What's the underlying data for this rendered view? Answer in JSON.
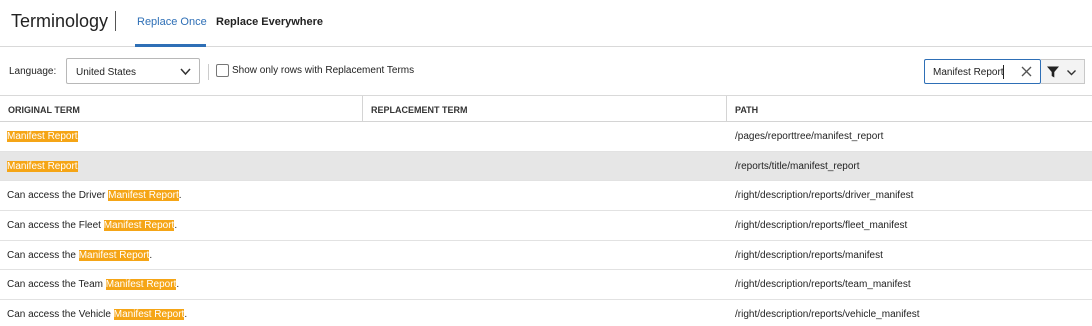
{
  "header": {
    "title": "Terminology",
    "tabs": [
      {
        "label": "Replace Once",
        "active": true
      },
      {
        "label": "Replace Everywhere",
        "active": false
      }
    ]
  },
  "toolbar": {
    "language_label": "Language:",
    "language_value": "United States",
    "checkbox_label": "Show only rows with Replacement Terms",
    "checkbox_checked": false,
    "search_value": "Manifest Report"
  },
  "table": {
    "columns": [
      "ORIGINAL TERM",
      "REPLACEMENT TERM",
      "PATH"
    ],
    "rows": [
      {
        "prefix": "",
        "match": "Manifest Report",
        "suffix": "",
        "replacement": "",
        "path": "/pages/reporttree/manifest_report"
      },
      {
        "prefix": "",
        "match": "Manifest Report",
        "suffix": "",
        "replacement": "",
        "path": "/reports/title/manifest_report"
      },
      {
        "prefix": "Can access the Driver ",
        "match": "Manifest Report",
        "suffix": ".",
        "replacement": "",
        "path": "/right/description/reports/driver_manifest"
      },
      {
        "prefix": "Can access the Fleet ",
        "match": "Manifest Report",
        "suffix": ".",
        "replacement": "",
        "path": "/right/description/reports/fleet_manifest"
      },
      {
        "prefix": "Can access the ",
        "match": "Manifest Report",
        "suffix": ".",
        "replacement": "",
        "path": "/right/description/reports/manifest"
      },
      {
        "prefix": "Can access the Team ",
        "match": "Manifest Report",
        "suffix": ".",
        "replacement": "",
        "path": "/right/description/reports/team_manifest"
      },
      {
        "prefix": "Can access the Vehicle ",
        "match": "Manifest Report",
        "suffix": ".",
        "replacement": "",
        "path": "/right/description/reports/vehicle_manifest"
      }
    ]
  },
  "colors": {
    "accent": "#2e6fb6",
    "highlight": "#f5a516",
    "selected_row": "#e6e6e6"
  }
}
